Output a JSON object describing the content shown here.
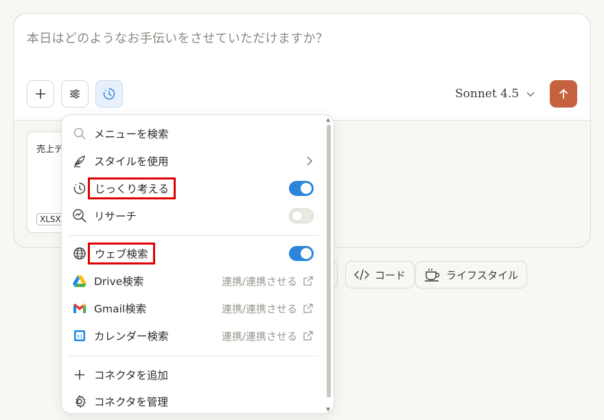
{
  "composer": {
    "placeholder": "本日はどのようなお手伝いをさせていただけますか？",
    "model_label": "Sonnet 4.5",
    "attachment": {
      "title": "売上デ",
      "type": "XLSX"
    }
  },
  "chips": [
    {
      "label": "コード",
      "icon": "code-icon"
    },
    {
      "label": "ライフスタイル",
      "icon": "coffee-cup-icon"
    }
  ],
  "menu": {
    "search_placeholder": "メニューを検索",
    "items": {
      "style": {
        "label": "スタイルを使用"
      },
      "think": {
        "label": "じっくり考える",
        "toggle": "on"
      },
      "research": {
        "label": "リサーチ",
        "toggle": "off"
      },
      "web": {
        "label": "ウェブ検索",
        "toggle": "on"
      },
      "drive": {
        "label": "Drive検索",
        "status": "連携/連携させる"
      },
      "gmail": {
        "label": "Gmail検索",
        "status": "連携/連携させる"
      },
      "calendar": {
        "label": "カレンダー検索",
        "status": "連携/連携させる",
        "calendar_day": "31"
      },
      "add_connector": {
        "label": "コネクタを追加"
      },
      "manage_connector": {
        "label": "コネクタを管理"
      }
    }
  },
  "colors": {
    "accent": "#c6613f",
    "toggle_on": "#2c84db",
    "highlight_box": "#e00000"
  }
}
